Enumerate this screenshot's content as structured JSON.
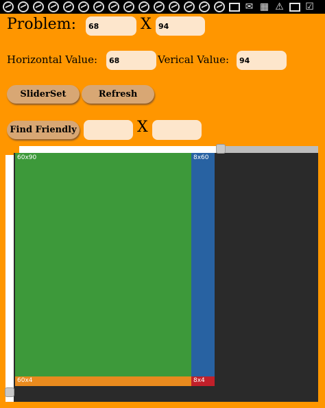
{
  "status_bar": {
    "icons": [
      "messenger-icon",
      "messenger-icon",
      "messenger-icon",
      "messenger-icon",
      "messenger-icon",
      "messenger-icon",
      "messenger-icon",
      "messenger-icon",
      "messenger-icon",
      "messenger-icon",
      "messenger-icon",
      "messenger-icon",
      "messenger-icon",
      "messenger-icon",
      "messenger-icon",
      "image-icon",
      "mail-icon",
      "grid-icon",
      "warning-icon",
      "screen-icon",
      "check-box-icon"
    ]
  },
  "problem": {
    "label": "Problem:",
    "width": "68",
    "separator": "X",
    "height": "94"
  },
  "values": {
    "horizontal_label": "Horizontal Value:",
    "horizontal": "68",
    "vertical_label": "Verical Value:",
    "vertical": "94"
  },
  "buttons": {
    "sliderset": "SliderSet",
    "refresh": "Refresh",
    "find_friendly": "Find Friendly"
  },
  "friendly": {
    "a": "",
    "separator": "X",
    "b": ""
  },
  "sliders": {
    "horizontal_fraction": 0.68,
    "vertical_fraction": 0.98
  },
  "canvas": {
    "cells": [
      {
        "label": "60x90",
        "color": "#3d993a"
      },
      {
        "label": "8x60",
        "color": "#2862a2"
      },
      {
        "label": "60x4",
        "color": "#e88a1e"
      },
      {
        "label": "8x4",
        "color": "#c1202a"
      }
    ],
    "background": "#2a2a2a"
  }
}
